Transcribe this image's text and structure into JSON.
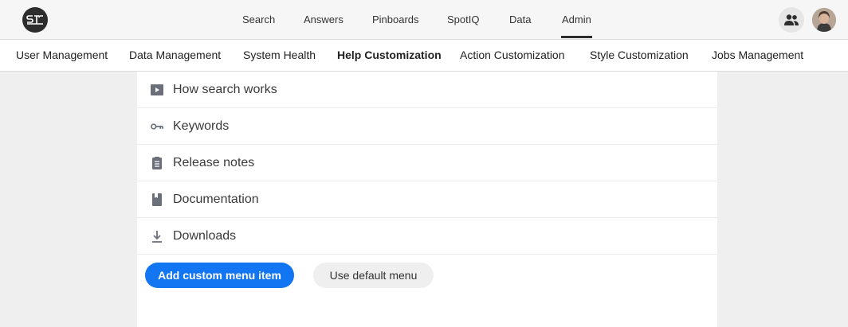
{
  "top_nav": {
    "items": [
      {
        "label": "Search",
        "active": false
      },
      {
        "label": "Answers",
        "active": false
      },
      {
        "label": "Pinboards",
        "active": false
      },
      {
        "label": "SpotIQ",
        "active": false
      },
      {
        "label": "Data",
        "active": false
      },
      {
        "label": "Admin",
        "active": true
      }
    ],
    "icons": {
      "logo": "thoughtspot-logo-icon",
      "people": "people-icon",
      "avatar": "user-avatar"
    }
  },
  "admin_tabs": {
    "items": [
      {
        "label": "User Management",
        "active": false
      },
      {
        "label": "Data Management",
        "active": false
      },
      {
        "label": "System Health",
        "active": false
      },
      {
        "label": "Help Customization",
        "active": true
      },
      {
        "label": "Action Customization",
        "active": false
      },
      {
        "label": "Style Customization",
        "active": false
      },
      {
        "label": "Jobs Management",
        "active": false
      }
    ]
  },
  "help_menu": {
    "items": [
      {
        "label": "How search works",
        "icon": "video-play-icon"
      },
      {
        "label": "Keywords",
        "icon": "key-icon"
      },
      {
        "label": "Release notes",
        "icon": "clipboard-icon"
      },
      {
        "label": "Documentation",
        "icon": "book-icon"
      },
      {
        "label": "Downloads",
        "icon": "download-icon"
      }
    ]
  },
  "actions": {
    "add_label": "Add custom menu item",
    "default_label": "Use default menu"
  },
  "colors": {
    "primary": "#1276f2",
    "icon": "#6a6f7a",
    "background": "#efefef"
  }
}
